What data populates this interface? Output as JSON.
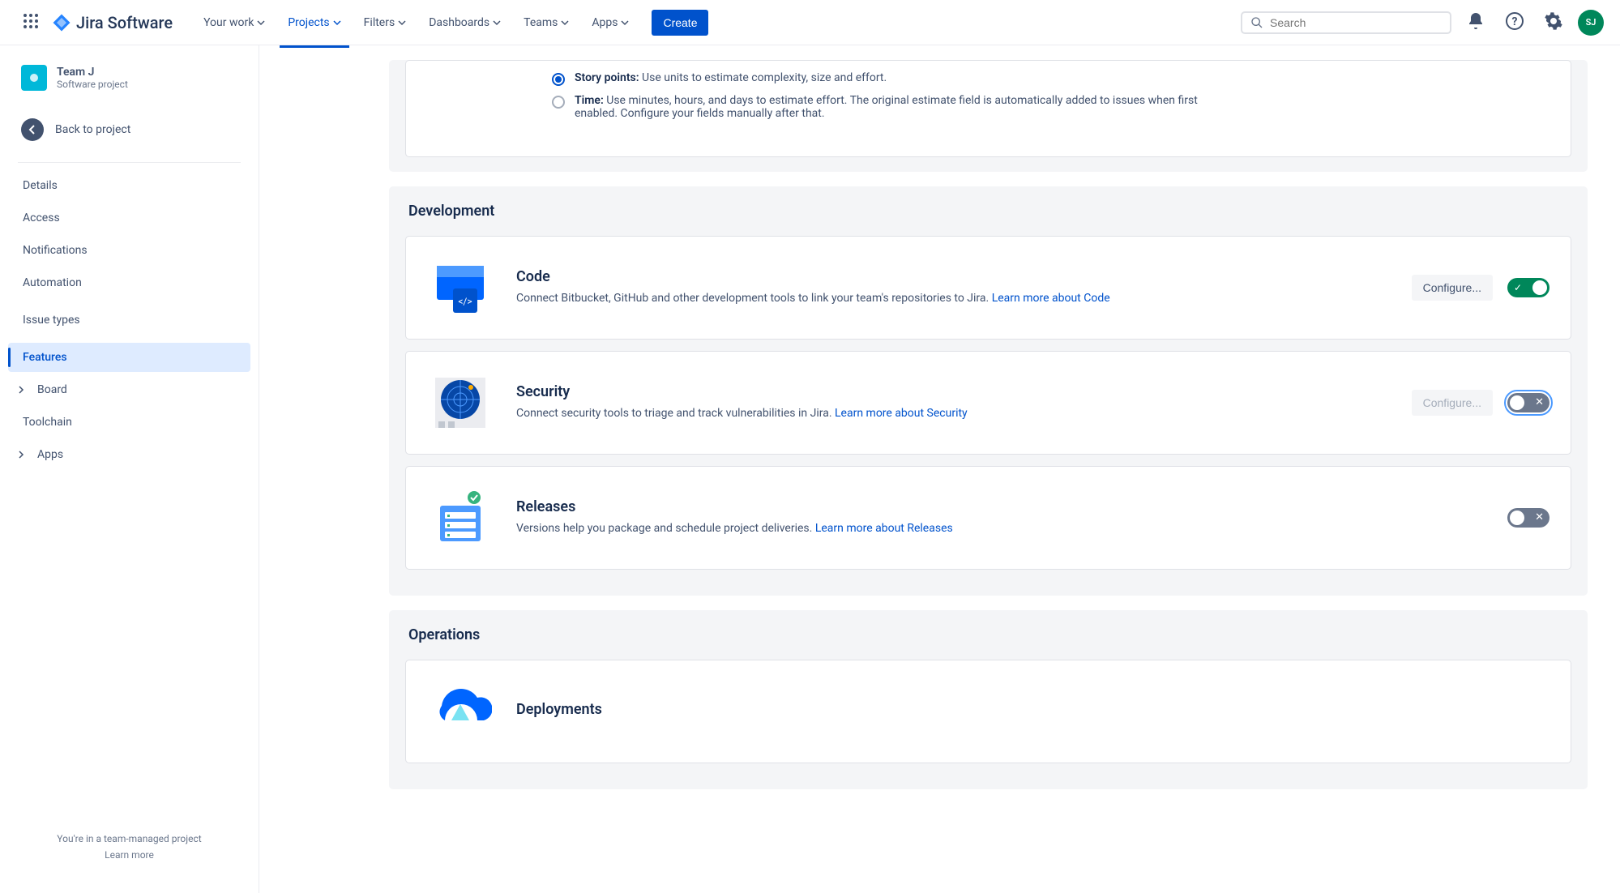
{
  "nav": {
    "logo": "Jira Software",
    "items": [
      "Your work",
      "Projects",
      "Filters",
      "Dashboards",
      "Teams",
      "Apps"
    ],
    "active_index": 1,
    "create": "Create",
    "search_placeholder": "Search",
    "avatar_initials": "SJ"
  },
  "project": {
    "name": "Team J",
    "type": "Software project"
  },
  "sidebar": {
    "back": "Back to project",
    "items": [
      "Details",
      "Access",
      "Notifications",
      "Automation",
      "Issue types",
      "Features",
      "Board",
      "Toolchain",
      "Apps"
    ],
    "selected_index": 5,
    "footer_text": "You're in a team-managed project",
    "footer_link": "Learn more"
  },
  "estimation": {
    "story_label": "Story points:",
    "story_desc": "Use units to estimate complexity, size and effort.",
    "time_label": "Time:",
    "time_desc": "Use minutes, hours, and days to estimate effort. The original estimate field is automatically added to issues when first enabled. Configure your fields manually after that."
  },
  "sections": {
    "development": "Development",
    "operations": "Operations"
  },
  "features": {
    "code": {
      "title": "Code",
      "desc": "Connect Bitbucket, GitHub and other development tools to link your team's repositories to Jira.",
      "link": "Learn more about Code",
      "configure": "Configure..."
    },
    "security": {
      "title": "Security",
      "desc": "Connect security tools to triage and track vulnerabilities in Jira.",
      "link": "Learn more about Security",
      "configure": "Configure..."
    },
    "releases": {
      "title": "Releases",
      "desc": "Versions help you package and schedule project deliveries.",
      "link": "Learn more about Releases"
    },
    "deployments": {
      "title": "Deployments"
    }
  }
}
